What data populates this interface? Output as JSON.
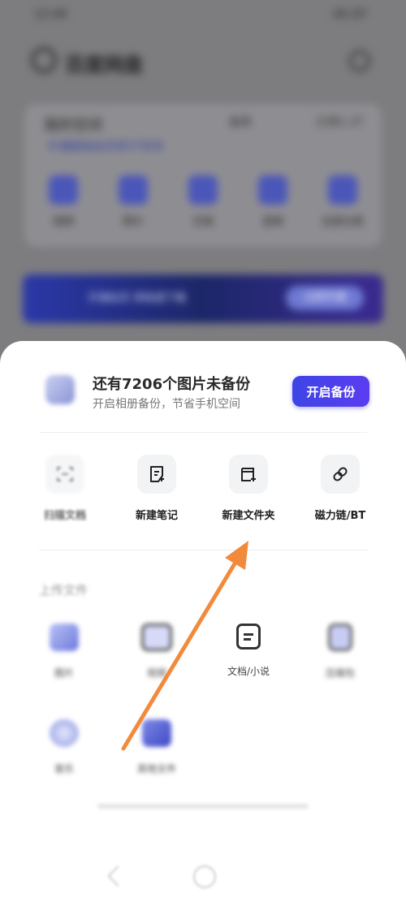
{
  "background": {
    "status_time": "12:49",
    "status_right": "4G  87",
    "app_title": "百度网盘",
    "storage_title": "我的空间",
    "storage_sub": "开通超级会员享5T空间",
    "storage_right_label": "会员",
    "storage_right_value": "已用1.2T",
    "categories": [
      {
        "label": "视频"
      },
      {
        "label": "照片"
      },
      {
        "label": "文档"
      },
      {
        "label": "音频"
      },
      {
        "label": "全部分类"
      }
    ],
    "banner_text": "开通会员 享极速下载",
    "banner_button": "立即开通"
  },
  "sheet": {
    "backup_title": "还有7206个图片未备份",
    "backup_subtitle": "开启相册备份，节省手机空间",
    "backup_button": "开启备份",
    "actions": [
      {
        "label": "扫描文档",
        "icon": "scan-icon"
      },
      {
        "label": "新建笔记",
        "icon": "note-add-icon"
      },
      {
        "label": "新建文件夹",
        "icon": "folder-add-icon"
      },
      {
        "label": "磁力链/BT",
        "icon": "link-icon"
      }
    ],
    "upload_heading": "上传文件",
    "uploads": [
      {
        "label": "图片",
        "icon": "image-icon"
      },
      {
        "label": "视频",
        "icon": "video-icon"
      },
      {
        "label": "文档/小说",
        "icon": "document-icon"
      },
      {
        "label": "压缩包",
        "icon": "archive-icon"
      },
      {
        "label": "音乐",
        "icon": "music-icon"
      },
      {
        "label": "其他文件",
        "icon": "file-icon"
      }
    ]
  },
  "colors": {
    "accent": "#4044e8",
    "annotation_arrow": "#f28a3c",
    "overlay": "#7d7d80"
  }
}
